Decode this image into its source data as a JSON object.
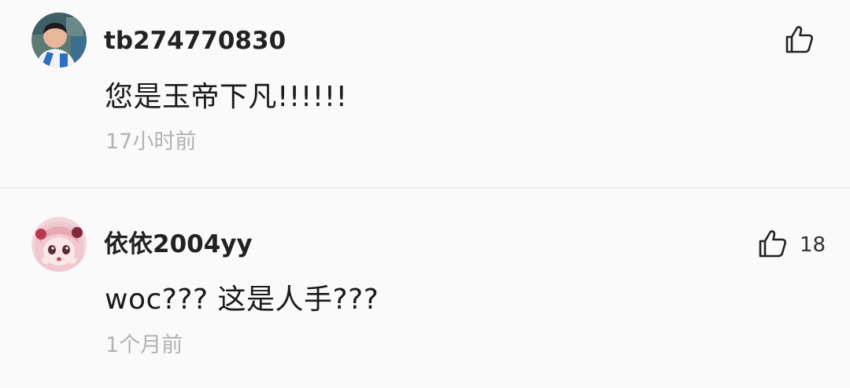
{
  "comments": [
    {
      "username": "tb274770830",
      "text": "您是玉帝下凡!!!!!!",
      "time": "17小时前",
      "likes": "",
      "avatar": "boy-photo-avatar"
    },
    {
      "username": "依依2004yy",
      "text": "woc???  这是人手???",
      "time": "1个月前",
      "likes": "18",
      "avatar": "anime-girl-avatar"
    }
  ],
  "icons": {
    "like": "thumbs-up-icon"
  },
  "colors": {
    "background": "#fafafa",
    "username": "#222222",
    "text": "#1a1a1a",
    "timestamp": "#b3b3b3",
    "divider": "#ececec"
  }
}
